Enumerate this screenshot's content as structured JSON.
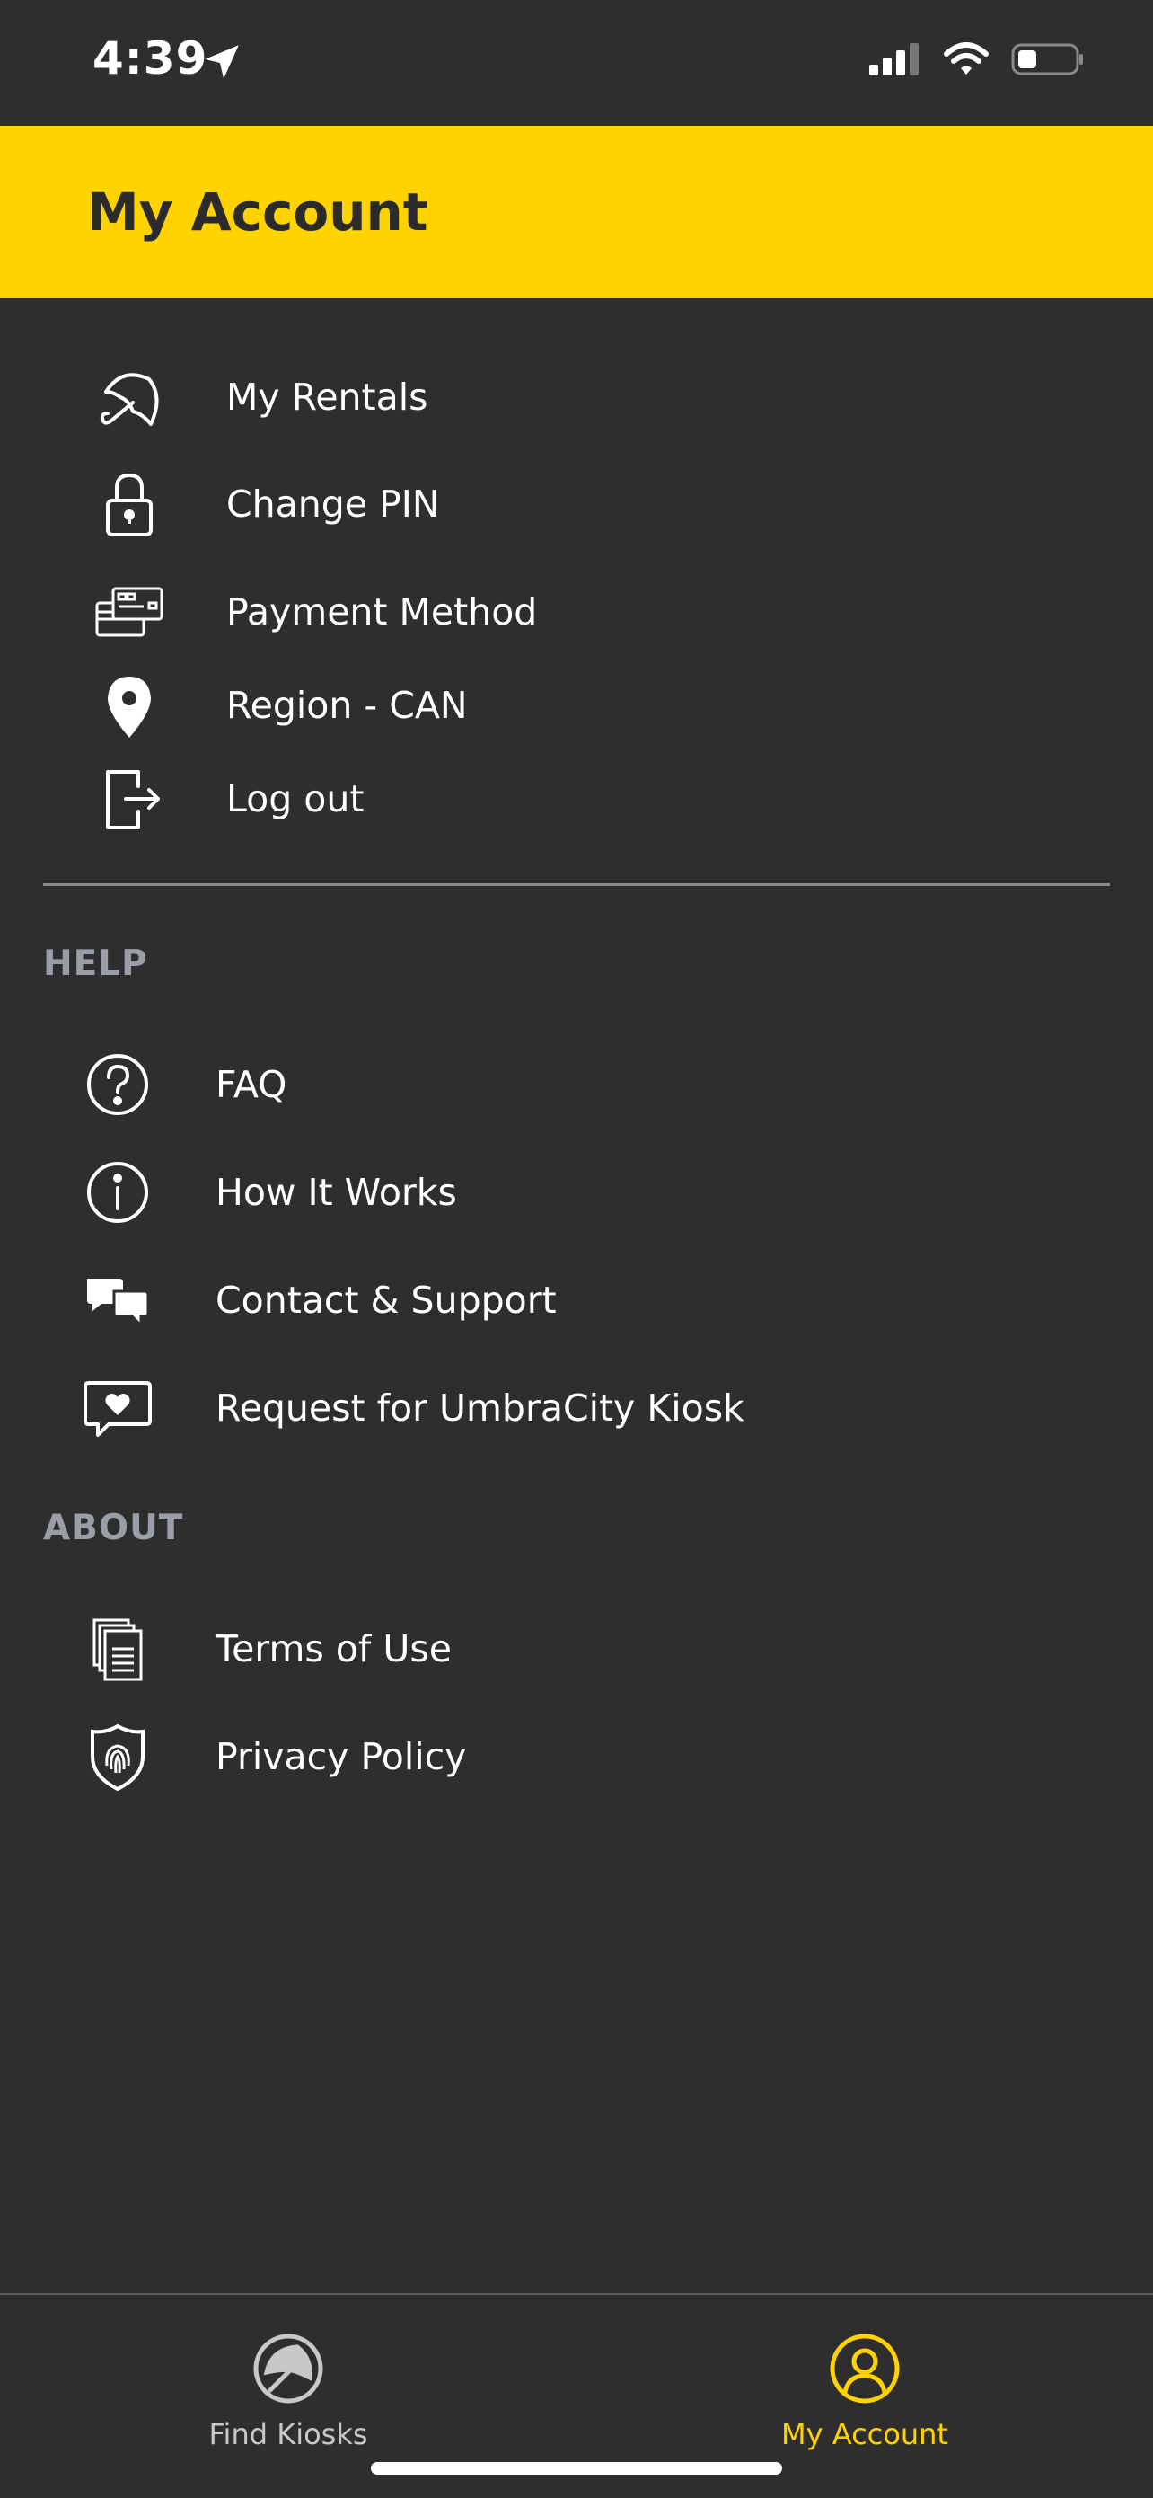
{
  "status_bar": {
    "time": "4:39"
  },
  "header": {
    "title": "My Account"
  },
  "account_items": [
    {
      "label": "My Rentals",
      "icon": "umbrella-icon"
    },
    {
      "label": "Change PIN",
      "icon": "lock-icon"
    },
    {
      "label": "Payment Method",
      "icon": "credit-card-icon"
    },
    {
      "label": "Region - CAN",
      "icon": "location-pin-icon"
    },
    {
      "label": "Log out",
      "icon": "logout-icon"
    }
  ],
  "help": {
    "title": "HELP",
    "items": [
      {
        "label": "FAQ",
        "icon": "question-circle-icon"
      },
      {
        "label": "How It Works",
        "icon": "info-circle-icon"
      },
      {
        "label": "Contact & Support",
        "icon": "chat-bubbles-icon"
      },
      {
        "label": "Request for UmbraCity Kiosk",
        "icon": "heart-message-icon"
      }
    ]
  },
  "about": {
    "title": "ABOUT",
    "items": [
      {
        "label": "Terms of Use",
        "icon": "documents-icon"
      },
      {
        "label": "Privacy Policy",
        "icon": "shield-fingerprint-icon"
      }
    ]
  },
  "tabs": [
    {
      "label": "Find Kiosks",
      "icon": "umbrella-kiosk-icon",
      "active": false
    },
    {
      "label": "My Account",
      "icon": "user-circle-icon",
      "active": true
    }
  ],
  "colors": {
    "accent": "#ffd300",
    "background": "#2e2e2e",
    "section_title": "#9a9ea6",
    "tab_inactive": "#c8c8c8"
  }
}
